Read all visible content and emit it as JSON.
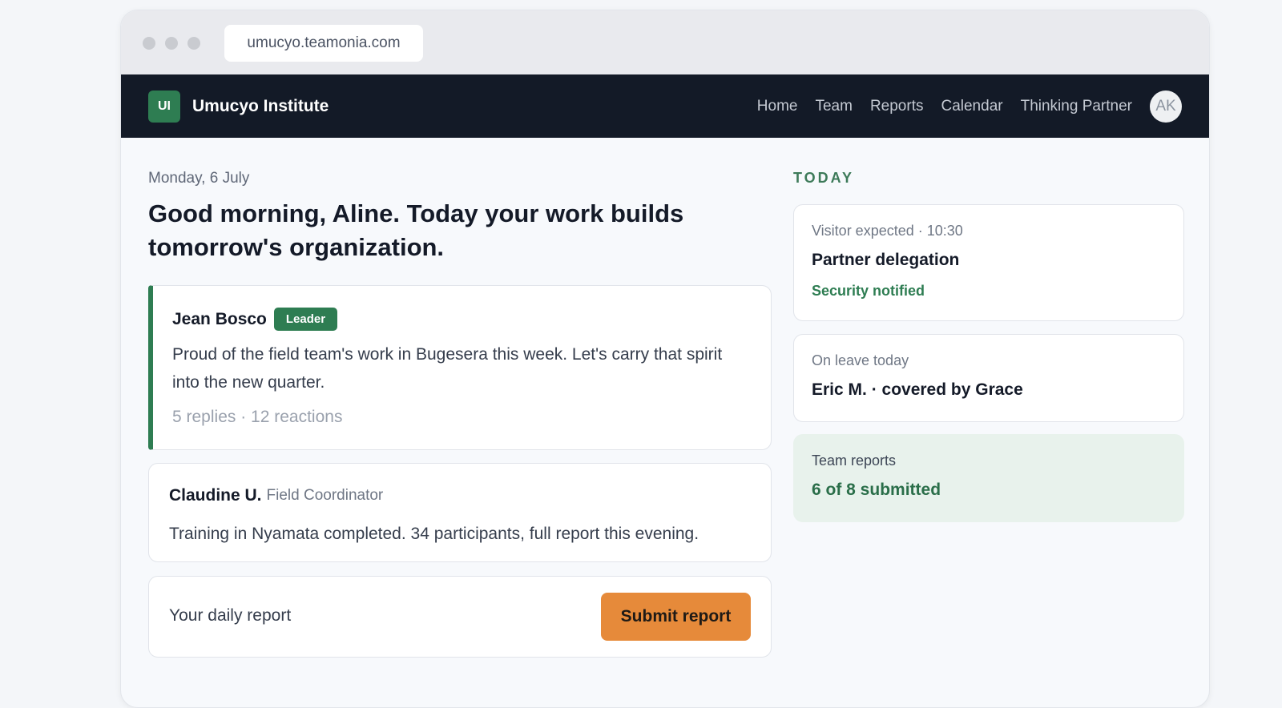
{
  "browser": {
    "url": "umucyo.teamonia.com"
  },
  "nav": {
    "logo": "UI",
    "brand": "Umucyo Institute",
    "links": [
      "Home",
      "Team",
      "Reports",
      "Calendar",
      "Thinking Partner"
    ],
    "avatar": "AK"
  },
  "main": {
    "date": "Monday, 6 July",
    "greeting": "Good morning, Aline. Today your work builds tomorrow's organization.",
    "posts": [
      {
        "author": "Jean Bosco",
        "badge": "Leader",
        "body": "Proud of the field team's work in Bugesera this week. Let's carry that spirit into the new quarter.",
        "meta": "5 replies · 12 reactions"
      },
      {
        "author": "Claudine U.",
        "role": "Field Coordinator",
        "body": "Training in Nyamata completed. 34 participants, full report this evening."
      }
    ],
    "report": {
      "label": "Your daily report",
      "button": "Submit report"
    }
  },
  "sidebar": {
    "heading": "TODAY",
    "cards": [
      {
        "label": "Visitor expected · 10:30",
        "title": "Partner delegation",
        "status": "Security notified"
      },
      {
        "label": "On leave today",
        "title": "Eric M. · covered by Grace"
      },
      {
        "label": "Team reports",
        "title": "6 of 8 submitted"
      }
    ]
  },
  "colors": {
    "accent_green": "#2e7d52",
    "nav_bg": "#131a27",
    "button_orange": "#e68a3a"
  }
}
